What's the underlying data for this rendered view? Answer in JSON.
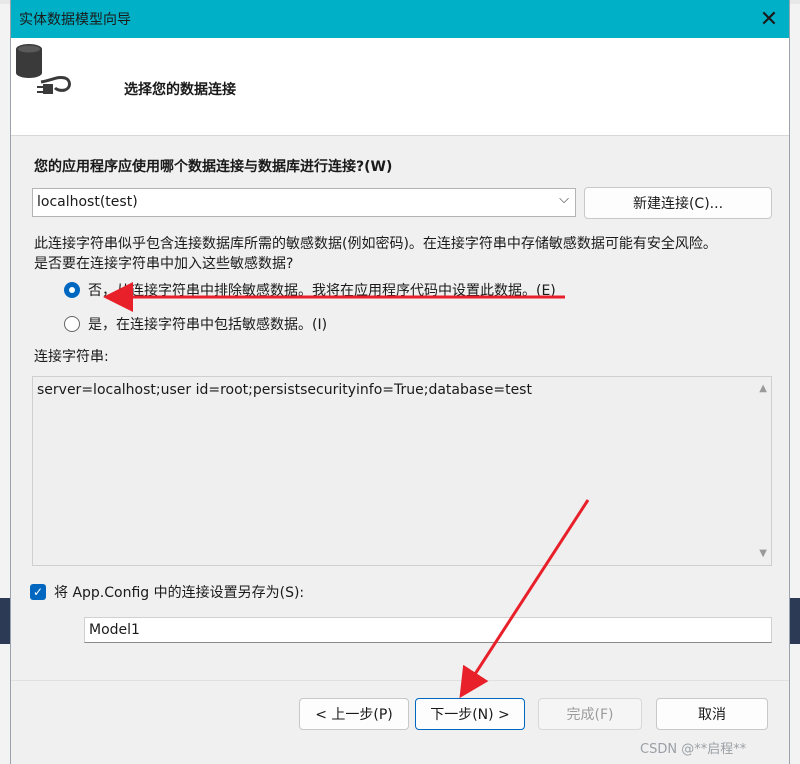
{
  "dialog": {
    "title": "实体数据模型向导",
    "header": "选择您的数据连接",
    "question": "您的应用程序应使用哪个数据连接与数据库进行连接?(W)",
    "connection": {
      "selected": "localhost(test)",
      "new_button": "新建连接(C)..."
    },
    "warning_line1": "此连接字符串似乎包含连接数据库所需的敏感数据(例如密码)。在连接字符串中存储敏感数据可能有安全风险。",
    "warning_line2": "是否要在连接字符串中加入这些敏感数据?",
    "radio_exclude": "否，从连接字符串中排除敏感数据。我将在应用程序代码中设置此数据。(E)",
    "radio_include": "是，在连接字符串中包括敏感数据。(I)",
    "connection_string_label": "连接字符串:",
    "connection_string": "server=localhost;user id=root;persistsecurityinfo=True;database=test",
    "save_checkbox_label": "将 App.Config 中的连接设置另存为(S):",
    "save_name": "Model1",
    "buttons": {
      "back": "< 上一步(P)",
      "next": "下一步(N) >",
      "finish": "完成(F)",
      "cancel": "取消"
    }
  },
  "watermark": "CSDN @**启程**",
  "colors": {
    "titlebar": "#00b0c6",
    "accent": "#0067c0",
    "annotation": "#e8202a"
  },
  "icons": {
    "close": "close-icon",
    "database_plug": "database-plug-icon",
    "dropdown": "chevron-down-icon",
    "check": "check-icon"
  }
}
